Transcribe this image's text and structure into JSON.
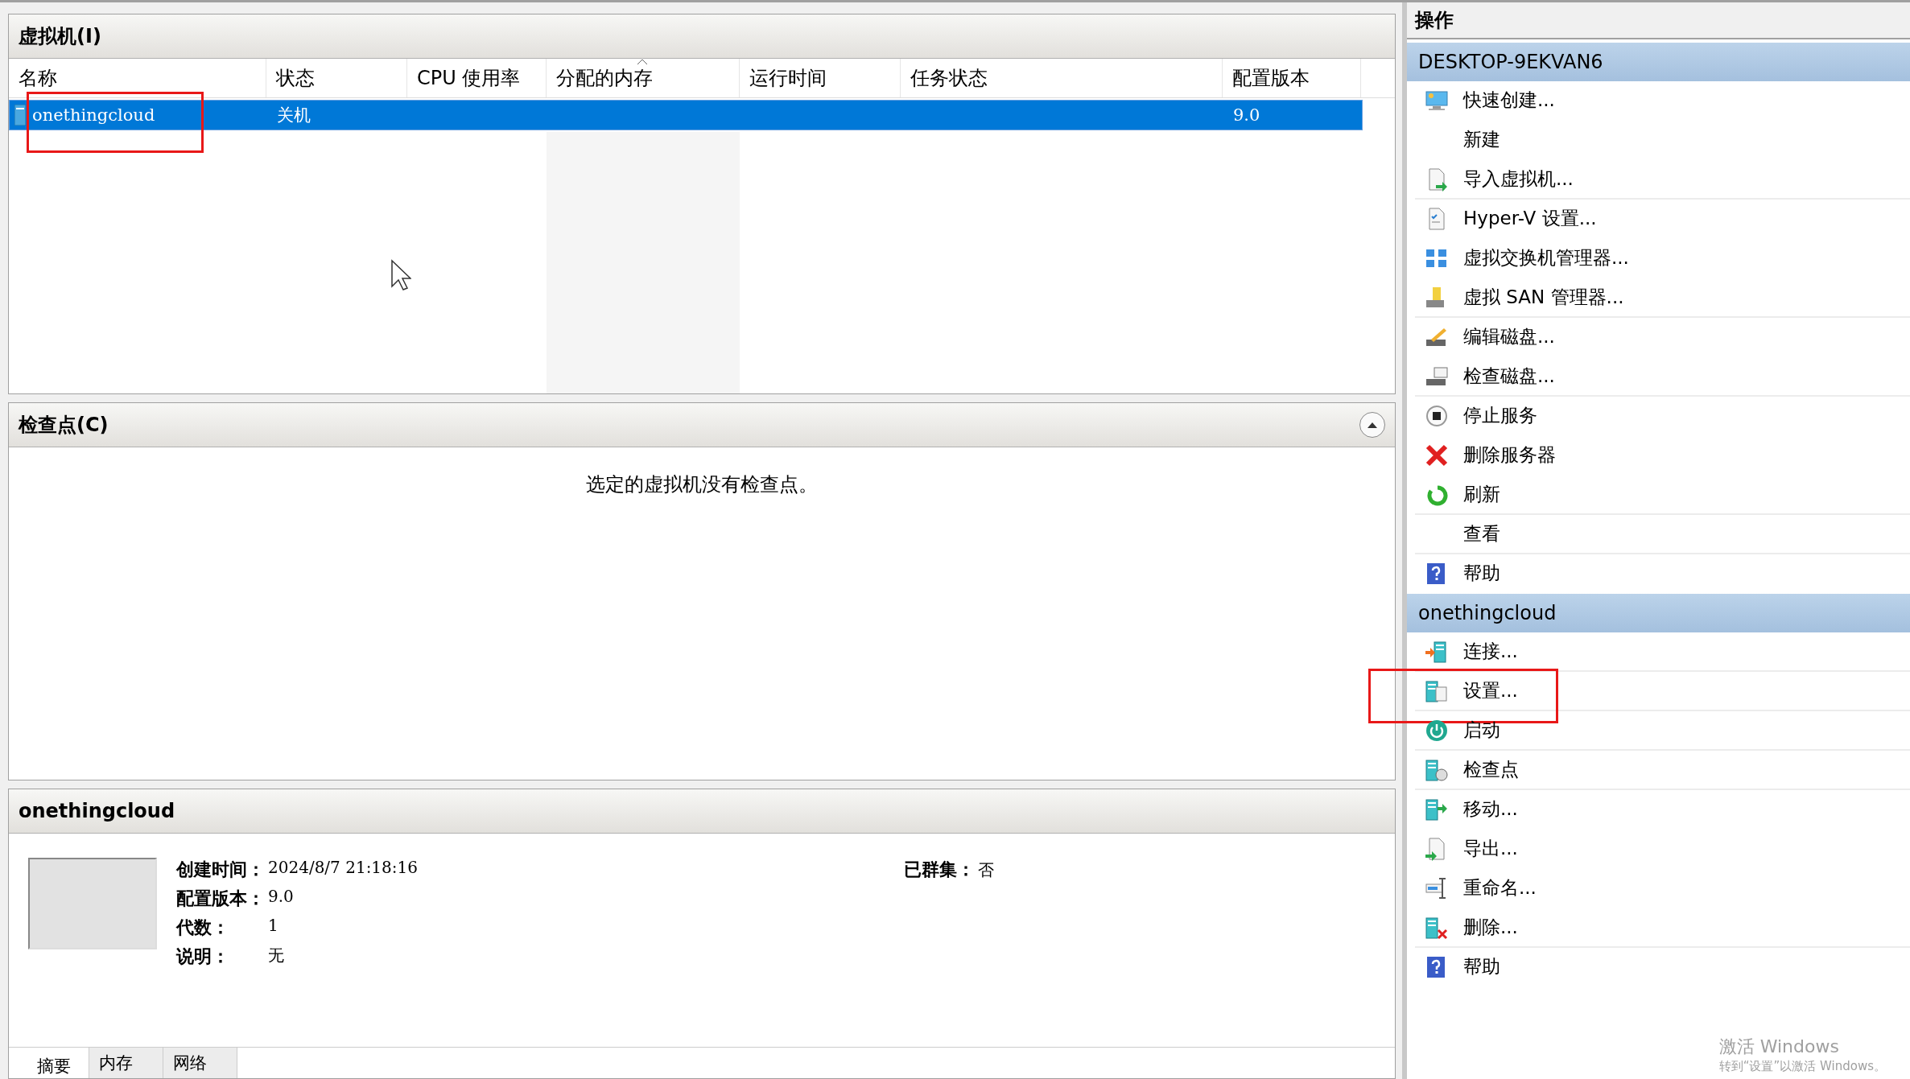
{
  "vm_panel": {
    "title": "虚拟机(I)",
    "columns": [
      {
        "label": "名称",
        "sorted": false
      },
      {
        "label": "状态",
        "sorted": false
      },
      {
        "label": "CPU 使用率",
        "sorted": false
      },
      {
        "label": "分配的内存",
        "sorted": true
      },
      {
        "label": "运行时间",
        "sorted": false
      },
      {
        "label": "任务状态",
        "sorted": false
      },
      {
        "label": "配置版本",
        "sorted": false
      }
    ],
    "rows": [
      {
        "selected": true,
        "annotated": true,
        "cells": [
          "onethingcloud",
          "关机",
          "",
          "",
          "",
          "",
          "9.0"
        ]
      }
    ]
  },
  "checkpoint_panel": {
    "title": "检查点(C)",
    "message": "选定的虚拟机没有检查点。"
  },
  "details_panel": {
    "title": "onethingcloud",
    "fields": [
      {
        "label": "创建时间：",
        "value": "2024/8/7 21:18:16"
      },
      {
        "label": "配置版本：",
        "value": "9.0"
      },
      {
        "label": "代数：",
        "value": "1"
      },
      {
        "label": "说明：",
        "value": "无"
      }
    ],
    "side_field": {
      "label": "已群集：",
      "value": "否"
    },
    "tabs": [
      {
        "label": "摘要",
        "selected": true
      },
      {
        "label": "内存",
        "selected": false
      },
      {
        "label": "网络",
        "selected": false
      }
    ]
  },
  "actions": {
    "title": "操作",
    "groups": [
      {
        "title": "DESKTOP-9EKVAN6",
        "items": [
          {
            "label": "快速创建...",
            "separator": false,
            "annotated": false
          },
          {
            "label": "新建",
            "separator": false,
            "annotated": false
          },
          {
            "label": "导入虚拟机...",
            "separator": true,
            "annotated": false
          },
          {
            "label": "Hyper-V 设置...",
            "separator": false,
            "annotated": false
          },
          {
            "label": "虚拟交换机管理器...",
            "separator": false,
            "annotated": false
          },
          {
            "label": "虚拟 SAN 管理器...",
            "separator": true,
            "annotated": false
          },
          {
            "label": "编辑磁盘...",
            "separator": false,
            "annotated": false
          },
          {
            "label": "检查磁盘...",
            "separator": true,
            "annotated": false
          },
          {
            "label": "停止服务",
            "separator": false,
            "annotated": false
          },
          {
            "label": "删除服务器",
            "separator": false,
            "annotated": false
          },
          {
            "label": "刷新",
            "separator": true,
            "annotated": false
          },
          {
            "label": "查看",
            "separator": true,
            "annotated": false
          },
          {
            "label": "帮助",
            "separator": false,
            "annotated": false
          }
        ]
      },
      {
        "title": "onethingcloud",
        "items": [
          {
            "label": "连接...",
            "separator": true,
            "annotated": false
          },
          {
            "label": "设置...",
            "separator": true,
            "annotated": true
          },
          {
            "label": "启动",
            "separator": true,
            "annotated": false
          },
          {
            "label": "检查点",
            "separator": true,
            "annotated": false
          },
          {
            "label": "移动...",
            "separator": false,
            "annotated": false
          },
          {
            "label": "导出...",
            "separator": false,
            "annotated": false
          },
          {
            "label": "重命名...",
            "separator": false,
            "annotated": false
          },
          {
            "label": "删除...",
            "separator": true,
            "annotated": false
          },
          {
            "label": "帮助",
            "separator": false,
            "annotated": false
          }
        ]
      }
    ]
  },
  "activation_notice": {
    "title": "激活 Windows",
    "subtitle": "转到“设置”以激活 Windows。"
  }
}
